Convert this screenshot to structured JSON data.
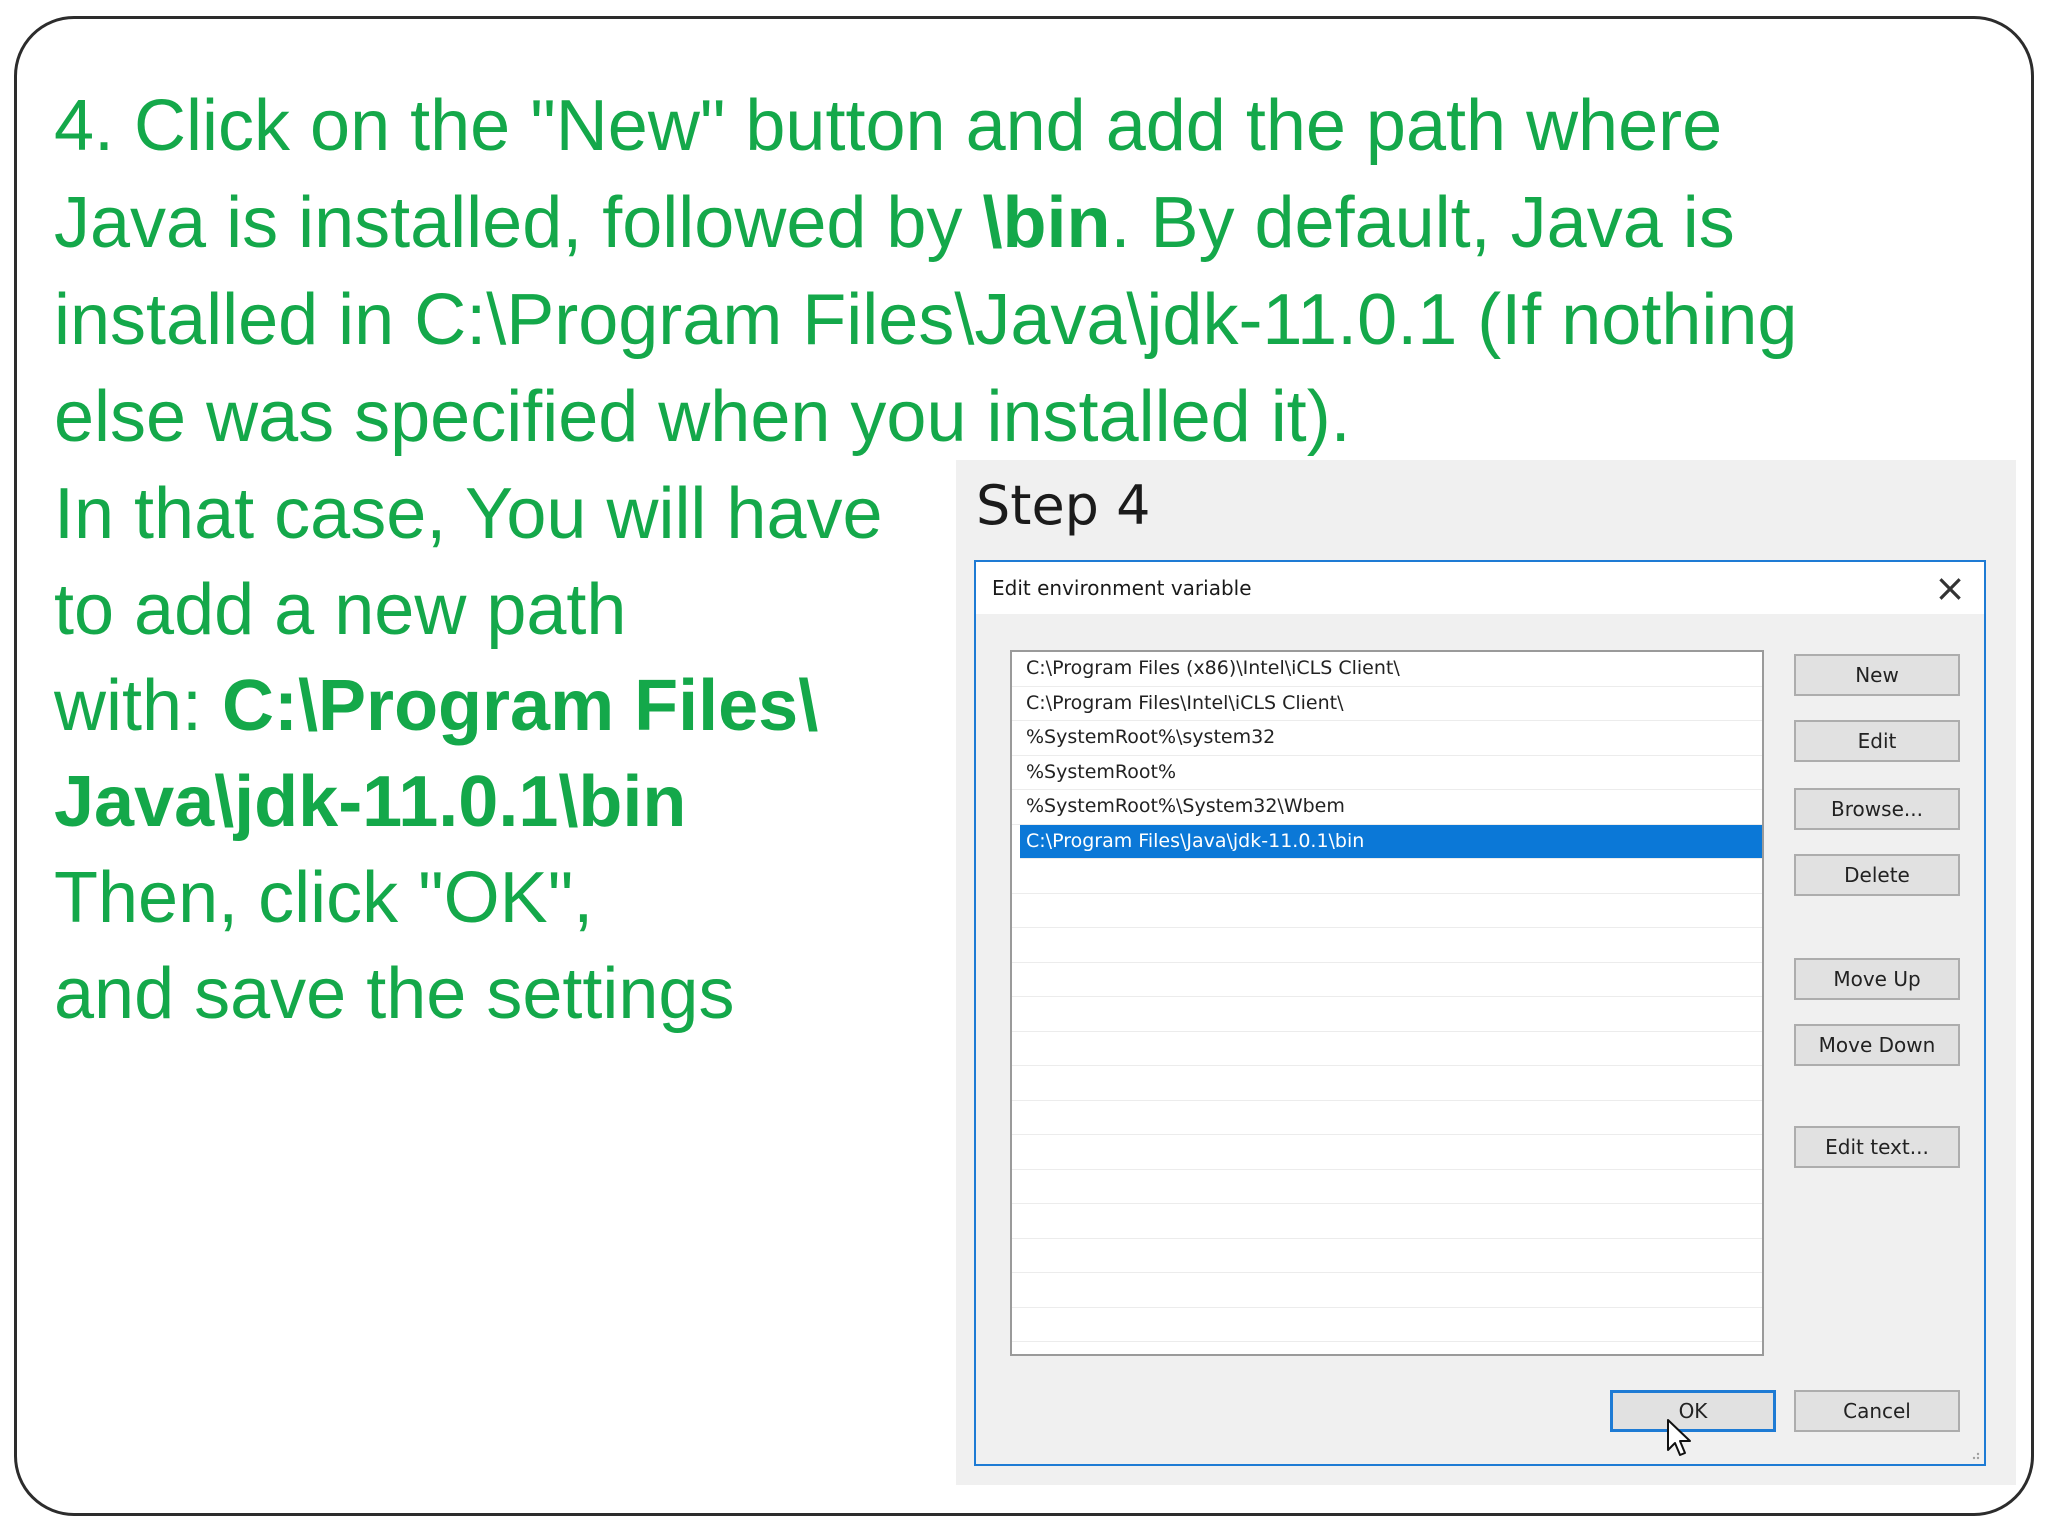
{
  "slide": {
    "paragraph": {
      "line1": "4. Click on the \"New\" button and add the path where",
      "line2_a": "Java is installed, followed by ",
      "line2_b": "\\bin",
      "line2_c": ". By default, Java is",
      "line3": "installed in C:\\Program Files\\Java\\jdk-11.0.1 (If nothing",
      "line4": "else was specified when you installed it)."
    },
    "instructions": {
      "line1": "In that case, You will have",
      "line2": "to add a new path",
      "line3_a": "with: ",
      "line3_b": "C:\\Program Files\\",
      "line4": "Java\\jdk-11.0.1\\bin",
      "line5": "Then, click \"OK\",",
      "line6": "and save the settings"
    },
    "text_color": "#14a84a"
  },
  "screenshot": {
    "caption": "Step 4",
    "dialog": {
      "title": "Edit environment variable",
      "close_icon": "close-icon",
      "entries": [
        "C:\\Program Files (x86)\\Intel\\iCLS Client\\",
        "C:\\Program Files\\Intel\\iCLS Client\\",
        "%SystemRoot%\\system32",
        "%SystemRoot%",
        "%SystemRoot%\\System32\\Wbem",
        "C:\\Program Files\\Java\\jdk-11.0.1\\bin"
      ],
      "selected_index": 5,
      "buttons": {
        "new": "New",
        "edit": "Edit",
        "browse": "Browse...",
        "delete": "Delete",
        "move_up": "Move Up",
        "move_down": "Move Down",
        "edit_text": "Edit text...",
        "ok": "OK",
        "cancel": "Cancel"
      },
      "accent_color": "#1e7bd4",
      "selection_color": "#0b78d7"
    }
  }
}
